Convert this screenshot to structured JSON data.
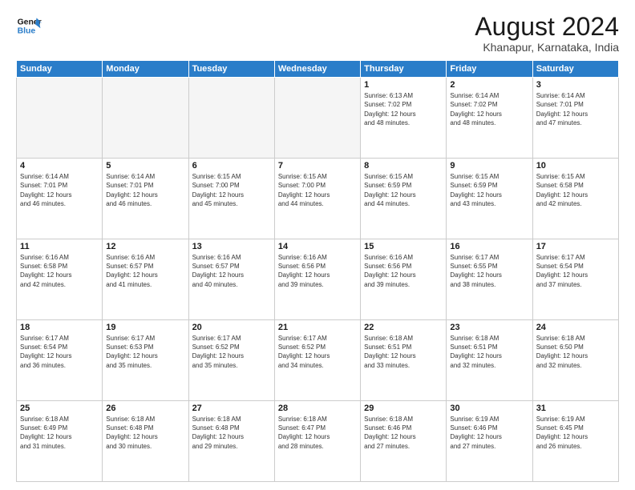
{
  "header": {
    "logo_line1": "General",
    "logo_line2": "Blue",
    "month_year": "August 2024",
    "location": "Khanapur, Karnataka, India"
  },
  "weekdays": [
    "Sunday",
    "Monday",
    "Tuesday",
    "Wednesday",
    "Thursday",
    "Friday",
    "Saturday"
  ],
  "weeks": [
    [
      {
        "day": "",
        "info": ""
      },
      {
        "day": "",
        "info": ""
      },
      {
        "day": "",
        "info": ""
      },
      {
        "day": "",
        "info": ""
      },
      {
        "day": "1",
        "info": "Sunrise: 6:13 AM\nSunset: 7:02 PM\nDaylight: 12 hours\nand 48 minutes."
      },
      {
        "day": "2",
        "info": "Sunrise: 6:14 AM\nSunset: 7:02 PM\nDaylight: 12 hours\nand 48 minutes."
      },
      {
        "day": "3",
        "info": "Sunrise: 6:14 AM\nSunset: 7:01 PM\nDaylight: 12 hours\nand 47 minutes."
      }
    ],
    [
      {
        "day": "4",
        "info": "Sunrise: 6:14 AM\nSunset: 7:01 PM\nDaylight: 12 hours\nand 46 minutes."
      },
      {
        "day": "5",
        "info": "Sunrise: 6:14 AM\nSunset: 7:01 PM\nDaylight: 12 hours\nand 46 minutes."
      },
      {
        "day": "6",
        "info": "Sunrise: 6:15 AM\nSunset: 7:00 PM\nDaylight: 12 hours\nand 45 minutes."
      },
      {
        "day": "7",
        "info": "Sunrise: 6:15 AM\nSunset: 7:00 PM\nDaylight: 12 hours\nand 44 minutes."
      },
      {
        "day": "8",
        "info": "Sunrise: 6:15 AM\nSunset: 6:59 PM\nDaylight: 12 hours\nand 44 minutes."
      },
      {
        "day": "9",
        "info": "Sunrise: 6:15 AM\nSunset: 6:59 PM\nDaylight: 12 hours\nand 43 minutes."
      },
      {
        "day": "10",
        "info": "Sunrise: 6:15 AM\nSunset: 6:58 PM\nDaylight: 12 hours\nand 42 minutes."
      }
    ],
    [
      {
        "day": "11",
        "info": "Sunrise: 6:16 AM\nSunset: 6:58 PM\nDaylight: 12 hours\nand 42 minutes."
      },
      {
        "day": "12",
        "info": "Sunrise: 6:16 AM\nSunset: 6:57 PM\nDaylight: 12 hours\nand 41 minutes."
      },
      {
        "day": "13",
        "info": "Sunrise: 6:16 AM\nSunset: 6:57 PM\nDaylight: 12 hours\nand 40 minutes."
      },
      {
        "day": "14",
        "info": "Sunrise: 6:16 AM\nSunset: 6:56 PM\nDaylight: 12 hours\nand 39 minutes."
      },
      {
        "day": "15",
        "info": "Sunrise: 6:16 AM\nSunset: 6:56 PM\nDaylight: 12 hours\nand 39 minutes."
      },
      {
        "day": "16",
        "info": "Sunrise: 6:17 AM\nSunset: 6:55 PM\nDaylight: 12 hours\nand 38 minutes."
      },
      {
        "day": "17",
        "info": "Sunrise: 6:17 AM\nSunset: 6:54 PM\nDaylight: 12 hours\nand 37 minutes."
      }
    ],
    [
      {
        "day": "18",
        "info": "Sunrise: 6:17 AM\nSunset: 6:54 PM\nDaylight: 12 hours\nand 36 minutes."
      },
      {
        "day": "19",
        "info": "Sunrise: 6:17 AM\nSunset: 6:53 PM\nDaylight: 12 hours\nand 35 minutes."
      },
      {
        "day": "20",
        "info": "Sunrise: 6:17 AM\nSunset: 6:52 PM\nDaylight: 12 hours\nand 35 minutes."
      },
      {
        "day": "21",
        "info": "Sunrise: 6:17 AM\nSunset: 6:52 PM\nDaylight: 12 hours\nand 34 minutes."
      },
      {
        "day": "22",
        "info": "Sunrise: 6:18 AM\nSunset: 6:51 PM\nDaylight: 12 hours\nand 33 minutes."
      },
      {
        "day": "23",
        "info": "Sunrise: 6:18 AM\nSunset: 6:51 PM\nDaylight: 12 hours\nand 32 minutes."
      },
      {
        "day": "24",
        "info": "Sunrise: 6:18 AM\nSunset: 6:50 PM\nDaylight: 12 hours\nand 32 minutes."
      }
    ],
    [
      {
        "day": "25",
        "info": "Sunrise: 6:18 AM\nSunset: 6:49 PM\nDaylight: 12 hours\nand 31 minutes."
      },
      {
        "day": "26",
        "info": "Sunrise: 6:18 AM\nSunset: 6:48 PM\nDaylight: 12 hours\nand 30 minutes."
      },
      {
        "day": "27",
        "info": "Sunrise: 6:18 AM\nSunset: 6:48 PM\nDaylight: 12 hours\nand 29 minutes."
      },
      {
        "day": "28",
        "info": "Sunrise: 6:18 AM\nSunset: 6:47 PM\nDaylight: 12 hours\nand 28 minutes."
      },
      {
        "day": "29",
        "info": "Sunrise: 6:18 AM\nSunset: 6:46 PM\nDaylight: 12 hours\nand 27 minutes."
      },
      {
        "day": "30",
        "info": "Sunrise: 6:19 AM\nSunset: 6:46 PM\nDaylight: 12 hours\nand 27 minutes."
      },
      {
        "day": "31",
        "info": "Sunrise: 6:19 AM\nSunset: 6:45 PM\nDaylight: 12 hours\nand 26 minutes."
      }
    ]
  ]
}
